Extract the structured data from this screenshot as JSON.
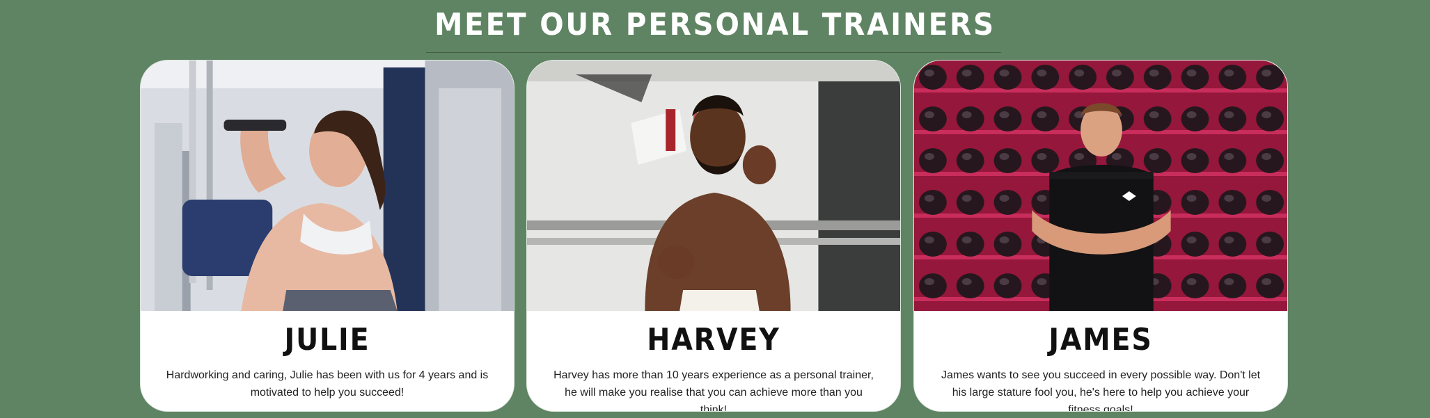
{
  "section": {
    "title": "MEET OUR PERSONAL TRAINERS"
  },
  "trainers": [
    {
      "name": "JULIE",
      "description": "Hardworking and caring, Julie has been with us for 4 years and is motivated to help you succeed!"
    },
    {
      "name": "HARVEY",
      "description": "Harvey has more than 10 years experience as a personal trainer, he will make you realise that you can achieve more than you think!"
    },
    {
      "name": "JAMES",
      "description": "James wants to see you succeed in every possible way. Don't let his large stature fool you, he's here to help you achieve your fitness goals!"
    }
  ],
  "colors": {
    "background": "#5f8463",
    "card": "#ffffff",
    "title_text": "#ffffff",
    "name_text": "#111111"
  }
}
